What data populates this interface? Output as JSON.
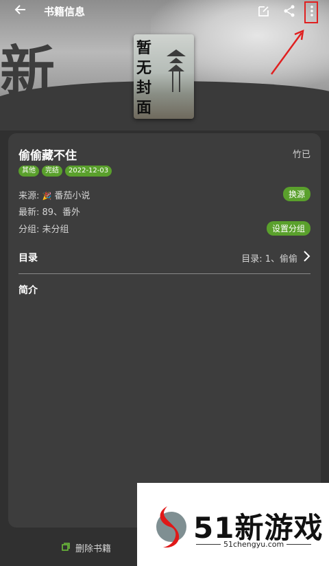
{
  "topbar": {
    "title": "书籍信息"
  },
  "cover": {
    "text": "暂无封面"
  },
  "book": {
    "name": "偷偷藏不住",
    "author": "竹已",
    "tags": [
      "其他",
      "完结",
      "2022-12-03"
    ],
    "source_label": "来源: ",
    "source_name": "番茄小说",
    "latest": "最新: 89、番外",
    "group": "分组: 未分组",
    "change_source": "换源",
    "set_group": "设置分组",
    "toc_label": "目录",
    "toc_value": "目录: 1、偷偷",
    "intro_label": "简介"
  },
  "bottom": {
    "delete_label": "删除书籍"
  },
  "watermark": {
    "name": "51新游戏",
    "url": "51chengyu.com"
  },
  "colors": {
    "accent": "#5aa02c",
    "highlight_box": "#e02020"
  },
  "icons": [
    "back-arrow-icon",
    "edit-icon",
    "share-icon",
    "more-vert-icon",
    "chevron-right-icon",
    "delete-book-icon"
  ]
}
